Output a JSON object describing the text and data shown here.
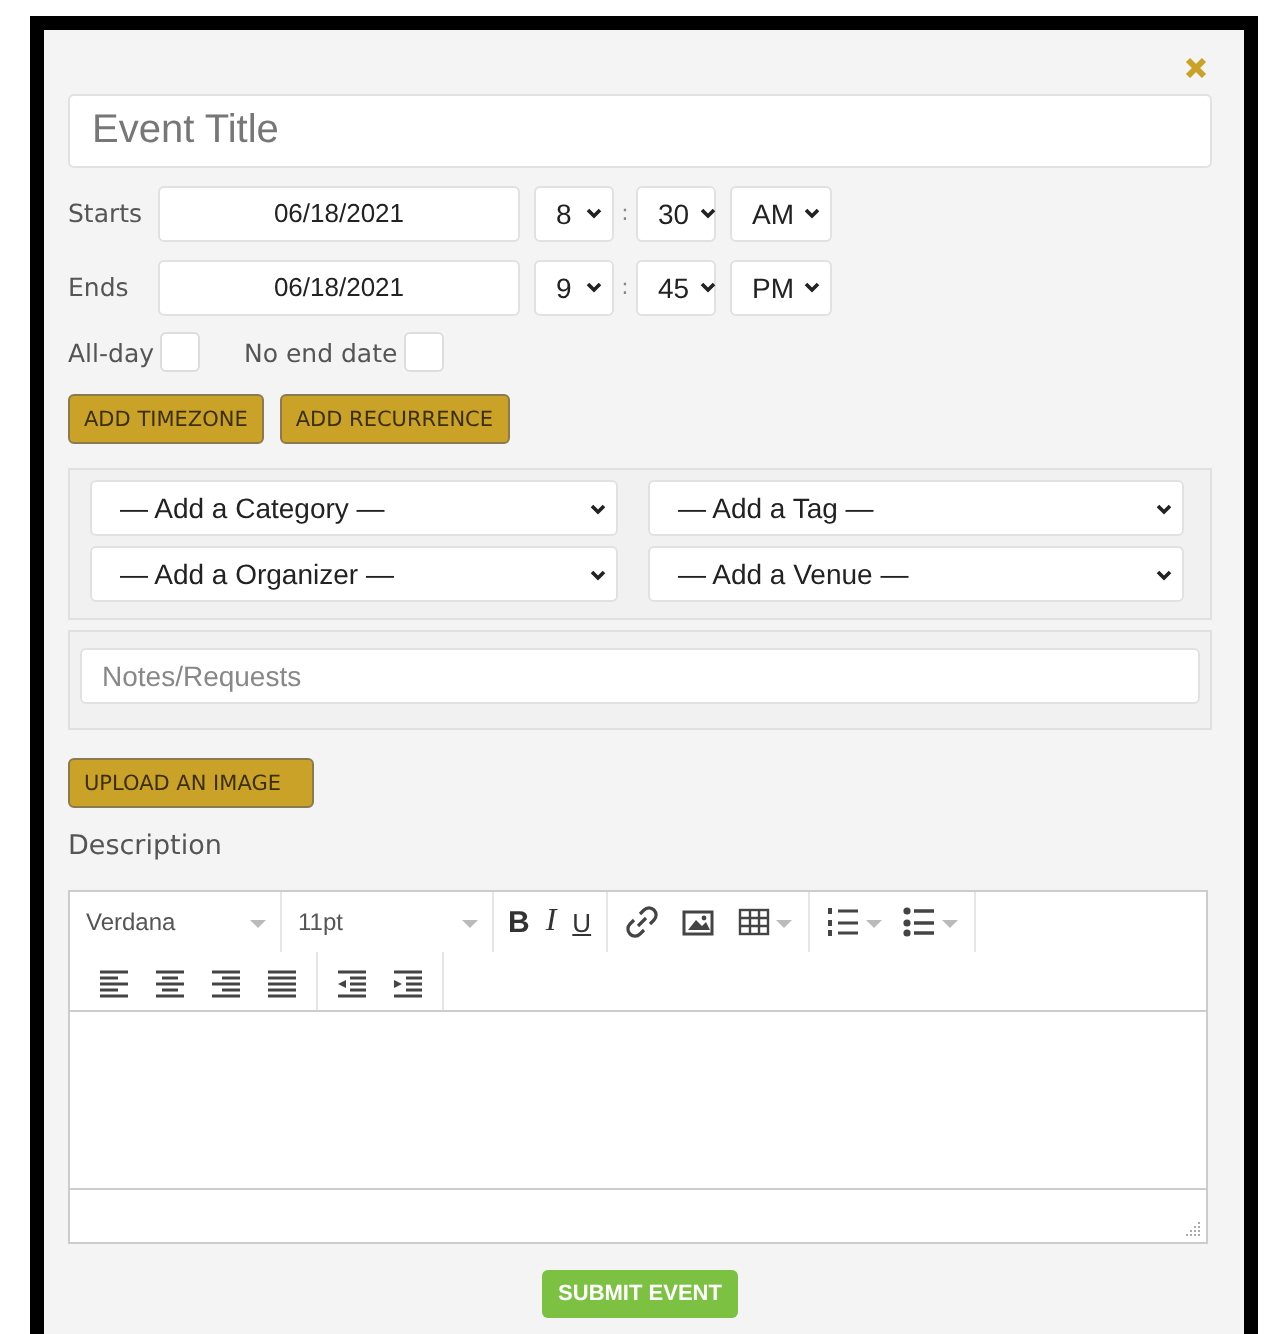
{
  "title_field": {
    "placeholder": "Event Title"
  },
  "times": [
    {
      "label": "Starts",
      "date": "06/18/2021",
      "hour": "8",
      "separator": ":",
      "minute": "30",
      "period": "AM"
    },
    {
      "label": "Ends",
      "date": "06/18/2021",
      "hour": "9",
      "separator": ":",
      "minute": "45",
      "period": "PM"
    }
  ],
  "options": [
    {
      "label": "All-day",
      "checked": false
    },
    {
      "label": "No end date",
      "checked": false
    }
  ],
  "buttons": [
    "ADD TIMEZONE",
    "ADD RECURRENCE"
  ],
  "selects": [
    "— Add a Category —",
    "— Add a Tag —",
    "— Add a Organizer —",
    "— Add a Venue —"
  ],
  "notes": {
    "placeholder": "Notes/Requests"
  },
  "upload_button": "UPLOAD AN IMAGE",
  "description_label": "Description",
  "editor": {
    "font": "Verdana",
    "size": "11pt",
    "toolbar": [
      [
        {
          "kind": "bold",
          "text": "B"
        },
        {
          "kind": "italic",
          "text": "I"
        },
        {
          "kind": "underline",
          "text": "U"
        }
      ],
      [
        {
          "kind": "link"
        },
        {
          "kind": "image"
        },
        {
          "kind": "table"
        }
      ],
      [
        {
          "kind": "numbered"
        },
        {
          "kind": "bulleted"
        }
      ],
      [
        {
          "kind": "align-left"
        },
        {
          "kind": "align-center"
        },
        {
          "kind": "align-right"
        },
        {
          "kind": "justify"
        }
      ],
      [
        {
          "kind": "outdent"
        },
        {
          "kind": "indent"
        }
      ]
    ]
  },
  "submit_button": "SUBMIT EVENT"
}
